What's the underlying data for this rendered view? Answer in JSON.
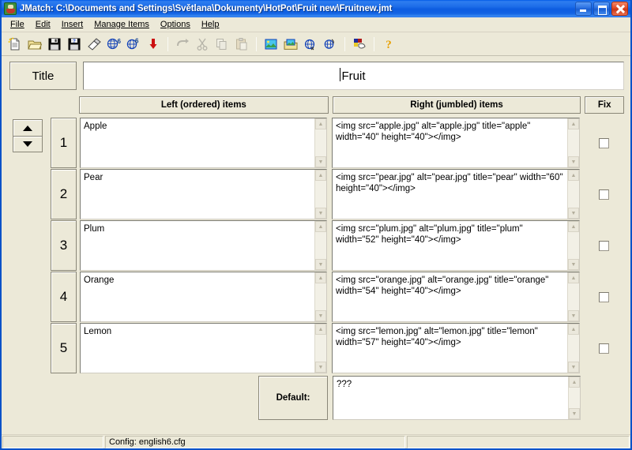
{
  "window": {
    "title": "JMatch: C:\\Documents and Settings\\Světlana\\Dokumenty\\HotPot\\Fruit new\\Fruitnew.jmt",
    "icon": "jmatch-app-icon",
    "buttons": {
      "minimize": "minimize-button",
      "maximize": "maximize-button",
      "close": "close-button"
    }
  },
  "menubar": {
    "items": [
      {
        "label": "File"
      },
      {
        "label": "Edit"
      },
      {
        "label": "Insert"
      },
      {
        "label": "Manage Items"
      },
      {
        "label": "Options"
      },
      {
        "label": "Help"
      }
    ]
  },
  "toolbar": {
    "buttons": [
      {
        "name": "new-file-icon",
        "title": "New"
      },
      {
        "name": "open-folder-icon",
        "title": "Open"
      },
      {
        "name": "save-icon",
        "title": "Save"
      },
      {
        "name": "save-as-icon",
        "title": "Save As"
      },
      {
        "name": "eraser-icon",
        "title": "Clear"
      },
      {
        "name": "web-page-icon",
        "title": "Export to web page"
      },
      {
        "name": "web-page-alt-icon",
        "title": "Export to web page (alt)"
      },
      {
        "name": "red-arrow-down-icon",
        "title": "Insert"
      },
      {
        "sep": true
      },
      {
        "name": "undo-icon",
        "title": "Undo",
        "disabled": true
      },
      {
        "name": "cut-icon",
        "title": "Cut",
        "disabled": true
      },
      {
        "name": "copy-icon",
        "title": "Copy",
        "disabled": true
      },
      {
        "name": "paste-icon",
        "title": "Paste",
        "disabled": true
      },
      {
        "sep": true
      },
      {
        "name": "globe-image-icon",
        "title": "Insert image"
      },
      {
        "name": "media-icon",
        "title": "Insert media"
      },
      {
        "name": "link-icon",
        "title": "Insert link"
      },
      {
        "name": "link-alt-icon",
        "title": "Insert link (alt)"
      },
      {
        "sep": true
      },
      {
        "name": "palette-icon",
        "title": "Configure"
      },
      {
        "sep": true
      },
      {
        "name": "help-question-icon",
        "title": "Help"
      }
    ]
  },
  "exercise": {
    "title_label": "Title",
    "title_value": "Fruit",
    "columns": {
      "left": "Left (ordered) items",
      "right": "Right (jumbled) items",
      "fix": "Fix"
    },
    "rows": [
      {
        "number": "1",
        "left": "Apple",
        "right": "<img src=\"apple.jpg\" alt=\"apple.jpg\" title=\"apple\" width=\"40\" height=\"40\"></img>",
        "fixed": false
      },
      {
        "number": "2",
        "left": "Pear",
        "right": "<img src=\"pear.jpg\" alt=\"pear.jpg\" title=\"pear\" width=\"60\" height=\"40\"></img>",
        "fixed": false
      },
      {
        "number": "3",
        "left": "Plum",
        "right": "<img src=\"plum.jpg\" alt=\"plum.jpg\" title=\"plum\" width=\"52\" height=\"40\"></img>",
        "fixed": false
      },
      {
        "number": "4",
        "left": "Orange",
        "right": "<img src=\"orange.jpg\" alt=\"orange.jpg\" title=\"orange\" width=\"54\" height=\"40\"></img>",
        "fixed": false
      },
      {
        "number": "5",
        "left": "Lemon",
        "right": "<img src=\"lemon.jpg\" alt=\"lemon.jpg\" title=\"lemon\" width=\"57\" height=\"40\"></img>",
        "fixed": false
      }
    ],
    "default_label": "Default:",
    "default_value": "???"
  },
  "navigation": {
    "move_up": "move-item-up",
    "move_down": "move-item-down"
  },
  "statusbar": {
    "left": "",
    "middle": "Config: english6.cfg",
    "right": ""
  },
  "colors": {
    "titlebar_blue": "#0a52c8",
    "face": "#ece9d8",
    "field_white": "#ffffff",
    "border_dark": "#8a8778",
    "desktop": "#d9d4c4"
  }
}
